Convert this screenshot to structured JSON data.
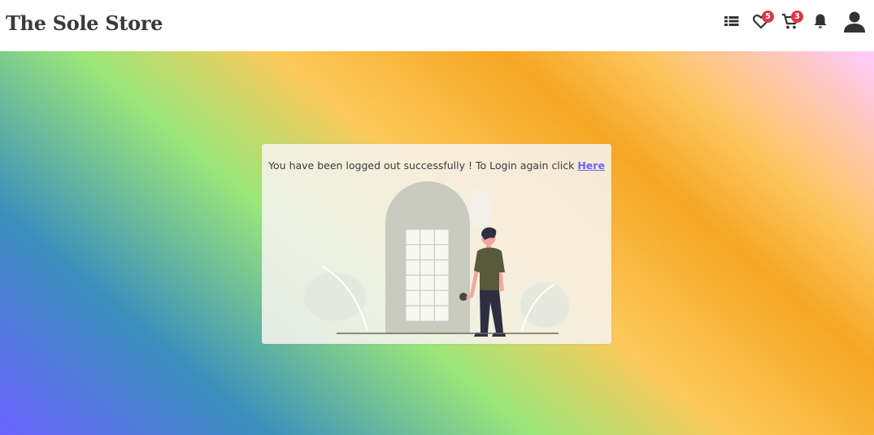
{
  "header": {
    "brand": "The Sole Store",
    "icons": [
      {
        "name": "list-icon"
      },
      {
        "name": "heart-icon",
        "badge": "5"
      },
      {
        "name": "cart-icon",
        "badge": "3"
      },
      {
        "name": "bell-icon"
      },
      {
        "name": "user-icon"
      }
    ]
  },
  "logout": {
    "message": "You have been logged out successfully ! To Login again click ",
    "link_label": "Here"
  },
  "colors": {
    "badge": "#dc3545",
    "link": "#6c63ff",
    "shirt": "#575a3b"
  }
}
